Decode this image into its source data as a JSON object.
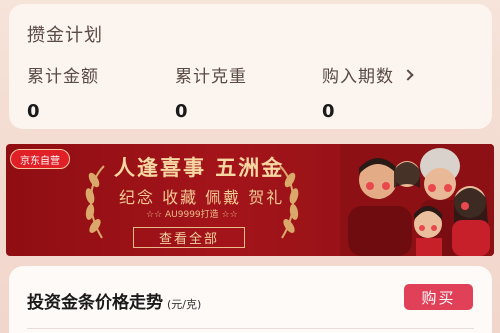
{
  "plan": {
    "title": "攒金计划",
    "stats": [
      {
        "label": "累计金额",
        "value": "0"
      },
      {
        "label": "累计克重",
        "value": "0"
      },
      {
        "label": "购入期数",
        "value": "0"
      }
    ]
  },
  "banner": {
    "badge": "京东自营",
    "headline": "人逢喜事 五洲金",
    "subline": "纪念 收藏 佩戴 贺礼",
    "au_text": "☆☆ AU9999打造 ☆☆",
    "cta": "查看全部"
  },
  "price_section": {
    "title": "投资金条价格走势",
    "unit": "(元/克)",
    "buy_label": "购买"
  },
  "colors": {
    "accent": "#e04158",
    "banner_red": "#9a1217",
    "gold_text": "#f6d2a2"
  }
}
